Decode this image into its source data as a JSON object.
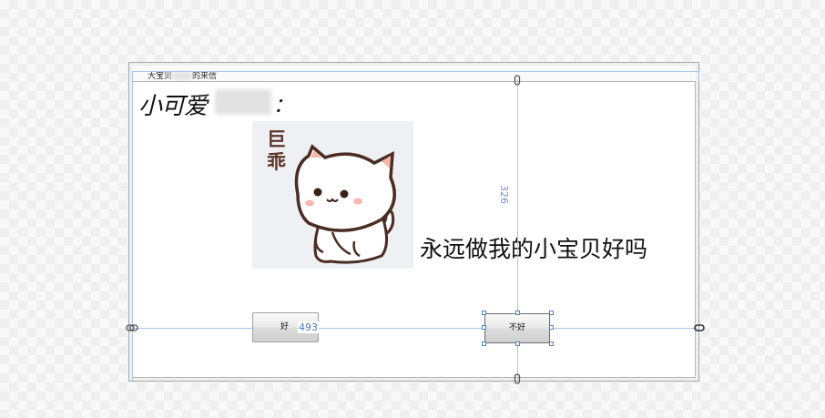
{
  "form": {
    "caption_prefix": "大宝贝",
    "caption_suffix": "的来信"
  },
  "content": {
    "greeting": "小可爱",
    "greeting_colon": "：",
    "sticker_text": "巨乖",
    "question": "永远做我的小宝贝好吗"
  },
  "buttons": {
    "yes_label": "好",
    "no_label": "不好"
  },
  "designer": {
    "height_measure": "326",
    "width_measure": "493"
  },
  "colors": {
    "guide": "#a9c6ec",
    "measure_text": "#4b77c0"
  },
  "icons": {
    "anchor": "link-anchor-icon",
    "sticker": "cat-sticker-image"
  }
}
